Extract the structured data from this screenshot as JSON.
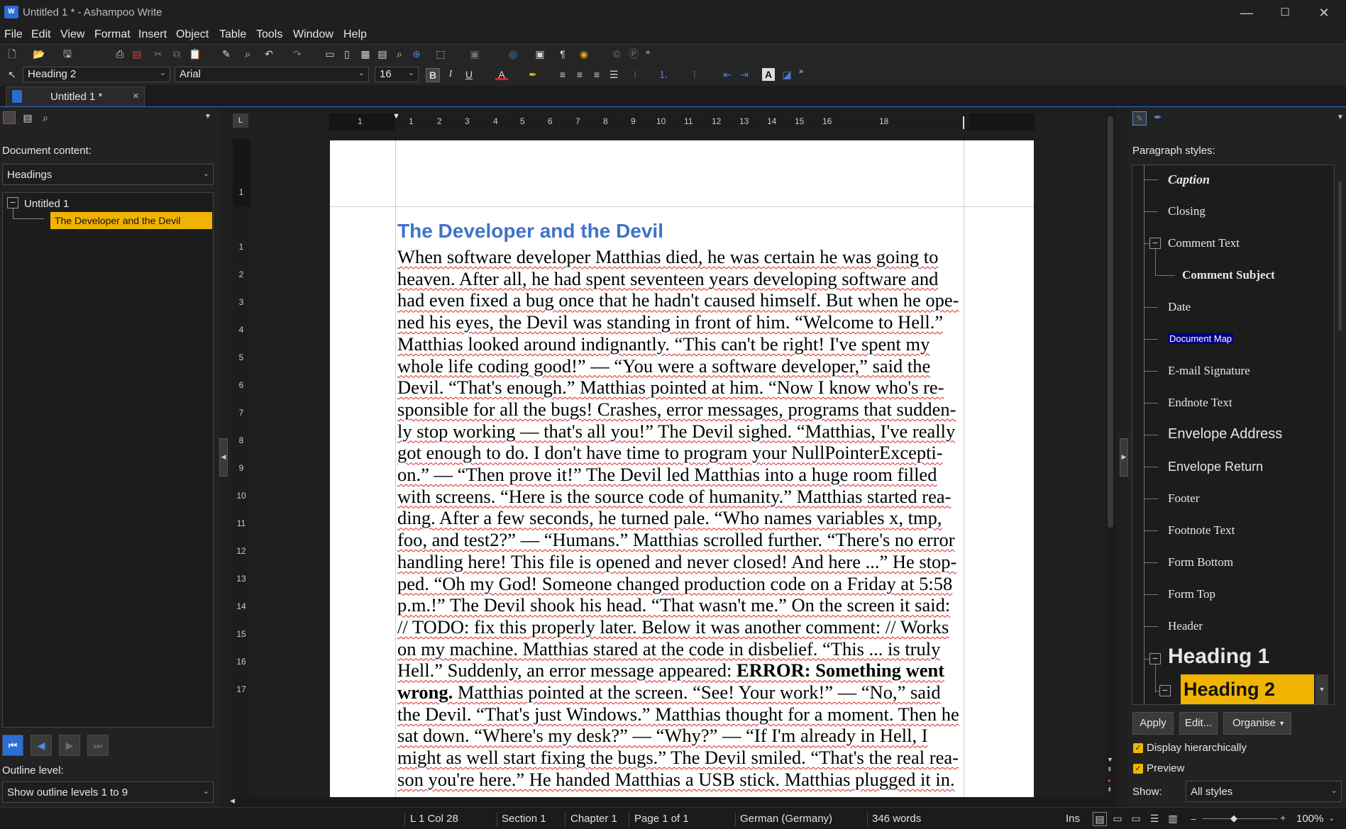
{
  "window": {
    "title": "Untitled 1 * - Ashampoo Write",
    "app_icon_text": "W",
    "controls": {
      "minimize": "—",
      "maximize": "☐",
      "close": "✕"
    }
  },
  "menu": [
    "File",
    "Edit",
    "View",
    "Format",
    "Insert",
    "Object",
    "Table",
    "Tools",
    "Window",
    "Help"
  ],
  "format_bar": {
    "paragraph_style": "Heading 2",
    "font": "Arial",
    "size": "16",
    "bold": "B",
    "italic": "I",
    "underline": "U",
    "font_color_glyph": "A"
  },
  "tab": {
    "label": "Untitled 1 *",
    "close": "×"
  },
  "left_panel": {
    "content_label": "Document content:",
    "content_select": "Headings",
    "tree": {
      "root": "Untitled 1",
      "child": "The Developer and the Devil",
      "expander": "−"
    },
    "outline_label": "Outline level:",
    "outline_select": "Show outline levels 1 to 9",
    "nav": [
      "⏮",
      "◀",
      "▶",
      "⏭"
    ]
  },
  "ruler": {
    "corner": "L",
    "h_numbers": [
      "1",
      "1",
      "2",
      "3",
      "4",
      "5",
      "6",
      "7",
      "8",
      "9",
      "10",
      "11",
      "12",
      "13",
      "14",
      "15",
      "16",
      "18"
    ],
    "v_numbers": [
      "1",
      "1",
      "2",
      "3",
      "4",
      "5",
      "6",
      "7",
      "8",
      "9",
      "10",
      "11",
      "12",
      "13",
      "14",
      "15",
      "16",
      "17"
    ]
  },
  "document": {
    "heading": "The Developer and the Devil",
    "body_parts": [
      "When software developer Matthias died, he was certain he was going to heaven. After all, he had spent seventeen years developing software and had even fixed a bug once that he hadn't caused himself. But when he ope-ned his eyes, the Devil was standing in front of him. “Welcome to Hell.” Matthias looked around indignantly. “This can't be right! I've spent my whole life coding good!” — “You were a software developer,” said the Devil. “That's enough.” Matthias pointed at him. “Now I know who's re-sponsible for all the bugs! Crashes, error messages, programs that sudden-ly stop working — that's all you!” The Devil sighed. “Matthias, I've really got enough to do. I don't have time to program your NullPointerExcepti-on.” — “Then prove it!” The Devil led Matthias into a huge room filled with screens. “Here is the source code of humanity.” Matthias started rea-ding. After a few seconds, he turned pale. “Who names variables x, tmp, foo, and test2?” — “Humans.” Matthias scrolled further. “There's no error handling here! This file is opened and never closed! And here ...” He stop-ped. “Oh my God! Someone changed production code on a Friday at 5:58 p.m.!” The Devil shook his head. “That wasn't me.” On the screen it said: // TODO: fix this properly later. Below it was another comment: // Works on my machine. Matthias stared at the code in disbelief. “This ... is truly Hell.” Suddenly, an error message appeared: ",
      "ERROR: Something went wrong.",
      " Matthias pointed at the screen. “See! Your work!” — “No,” said the Devil. “That's just Windows.” Matthias thought for a moment. Then he sat down. “Where's my desk?” — “Why?” — “If I'm already in Hell, I might as well start fixing the bugs.” The Devil smiled. “That's the real rea-son you're here.” He handed Matthias a USB stick. Matthias plugged it in."
    ]
  },
  "right_panel": {
    "label": "Paragraph styles:",
    "styles": [
      {
        "name": "Caption"
      },
      {
        "name": "Closing"
      },
      {
        "name": "Comment Text"
      },
      {
        "name": "Comment Subject"
      },
      {
        "name": "Date"
      },
      {
        "name": "Document Map"
      },
      {
        "name": "E-mail Signature"
      },
      {
        "name": "Endnote Text"
      },
      {
        "name": "Envelope Address"
      },
      {
        "name": "Envelope Return"
      },
      {
        "name": "Footer"
      },
      {
        "name": "Footnote Text"
      },
      {
        "name": "Form Bottom"
      },
      {
        "name": "Form Top"
      },
      {
        "name": "Header"
      },
      {
        "name": "Heading 1"
      },
      {
        "name": "Heading 2"
      }
    ],
    "buttons": {
      "apply": "Apply",
      "edit": "Edit...",
      "organise": "Organise"
    },
    "checks": {
      "hierarchical": "Display hierarchically",
      "preview": "Preview"
    },
    "show_label": "Show:",
    "show_select": "All styles",
    "accent": "#f0b400"
  },
  "status_bar": {
    "position": "L 1 Col 28",
    "section": "Section 1",
    "chapter": "Chapter 1",
    "page": "Page 1 of 1",
    "language": "German (Germany)",
    "words": "346 words",
    "mode": "Ins",
    "zoom": "100%"
  }
}
